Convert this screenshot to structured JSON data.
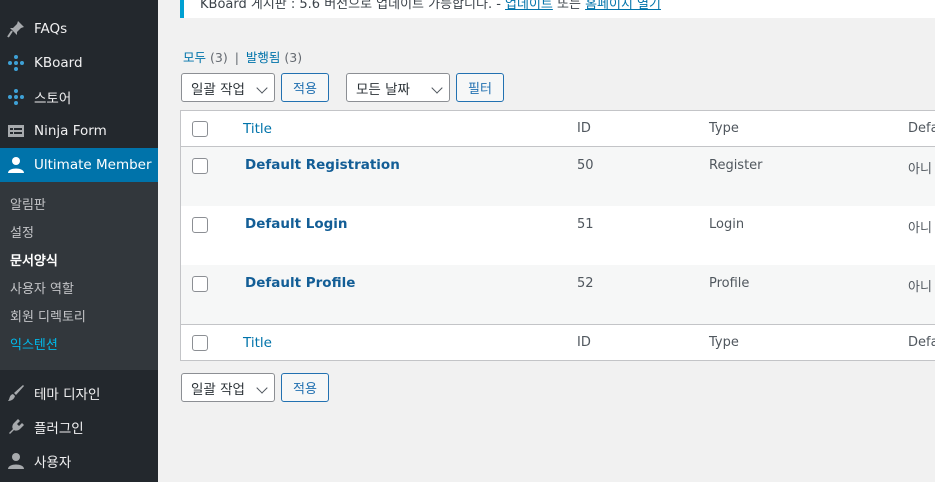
{
  "sidebar": {
    "items_top": [
      {
        "label": "FAQs",
        "icon": "pin-icon"
      },
      {
        "label": "KBoard",
        "icon": "dots-icon"
      },
      {
        "label": "스토어",
        "icon": "dots-icon"
      },
      {
        "label": "Ninja Form",
        "icon": "form-icon"
      },
      {
        "label": "Ultimate Member",
        "icon": "user-icon"
      }
    ],
    "submenu": [
      "알림판",
      "설정",
      "문서양식",
      "사용자 역할",
      "회원 디렉토리",
      "익스텐션"
    ],
    "items_bottom": [
      {
        "label": "테마 디자인",
        "icon": "brush-icon"
      },
      {
        "label": "플러그인",
        "icon": "plugin-icon"
      },
      {
        "label": "사용자",
        "icon": "user-icon"
      }
    ]
  },
  "notice": {
    "text": "KBoard 게시판 : 5.6 버전으로 업데이트 가능합니다. - ",
    "link1": "업데이트",
    "mid": " 또는 ",
    "link2": "홈페이지 열기"
  },
  "views": {
    "all_label": "모두",
    "all_count": "(3)",
    "sep": "|",
    "published_label": "발행됨",
    "published_count": "(3)"
  },
  "controls": {
    "bulk_action": "일괄 작업",
    "apply": "적용",
    "date_filter": "모든 날짜",
    "filter": "필터"
  },
  "table": {
    "headers": {
      "title": "Title",
      "id": "ID",
      "type": "Type",
      "default": "Defa"
    },
    "rows": [
      {
        "title": "Default Registration",
        "id": "50",
        "type": "Register",
        "default": "아니"
      },
      {
        "title": "Default Login",
        "id": "51",
        "type": "Login",
        "default": "아니"
      },
      {
        "title": "Default Profile",
        "id": "52",
        "type": "Profile",
        "default": "아니"
      }
    ]
  },
  "colors": {
    "sidebar_bg": "#23282d",
    "active_bg": "#0073aa",
    "link": "#0073aa",
    "accent": "#00b9eb"
  }
}
